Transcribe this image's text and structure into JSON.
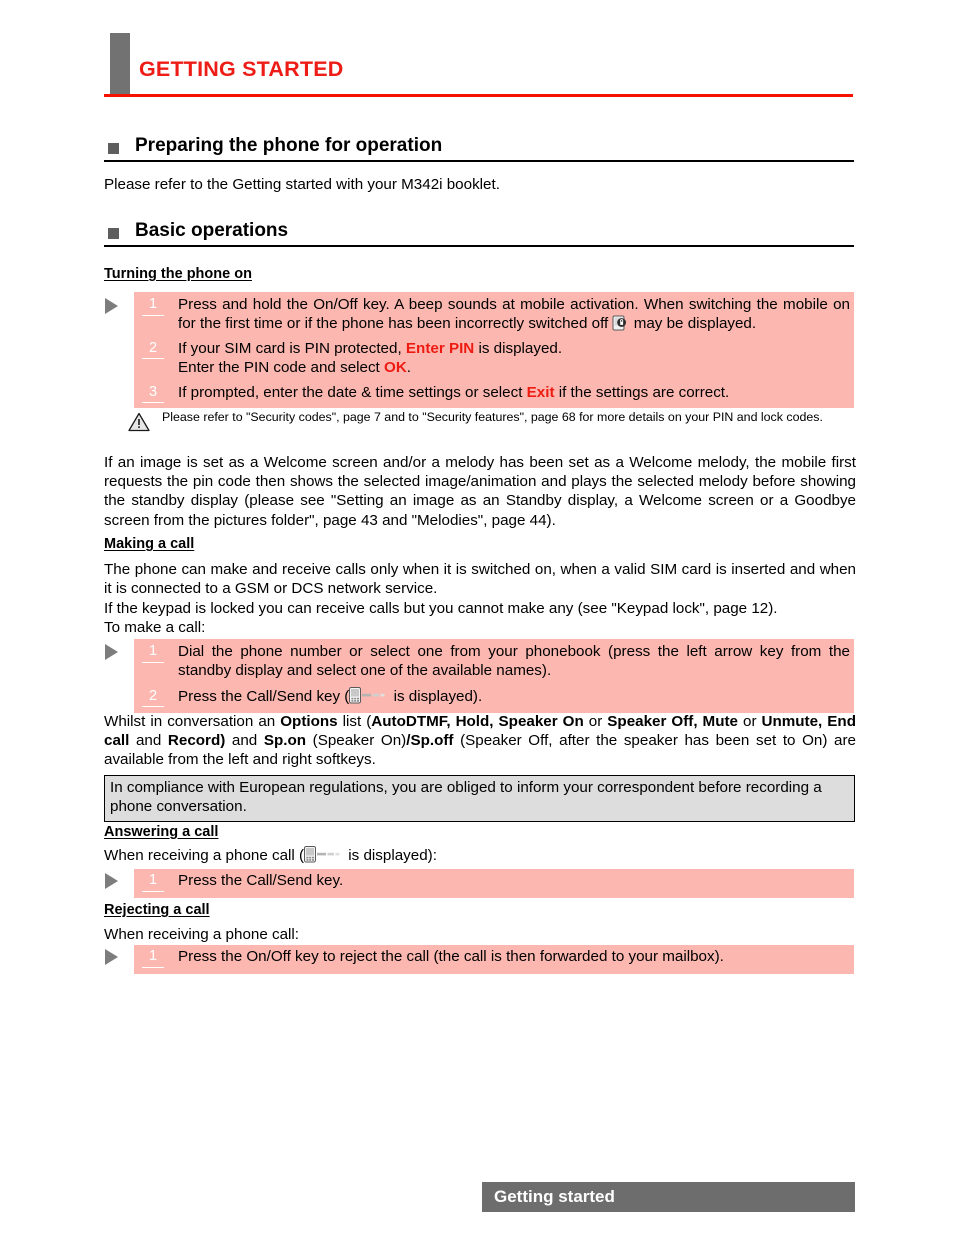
{
  "chapter": {
    "title": "GETTING STARTED",
    "accent_color": "#ed1c16",
    "tab_color": "#727272"
  },
  "sections": [
    {
      "id": "preparing",
      "title": "Preparing the phone for operation",
      "body": "Please refer to the Getting started with your M342i booklet."
    },
    {
      "id": "basic",
      "title": "Basic operations"
    }
  ],
  "turning_on": {
    "heading": "Turning the phone on",
    "steps": [
      {
        "num": "1",
        "text_a": "Press and hold the On/Off key. A beep sounds at mobile activation. When switching the mobile on for the first time or if the phone has been incorrectly switched off ",
        "icon": "lock-phone-icon",
        "text_b": " may be displayed."
      },
      {
        "num": "2",
        "text_a": "If your SIM card is PIN protected, ",
        "red_a": "Enter PIN",
        "text_b": " is displayed.",
        "text_c": "Enter the PIN code and select ",
        "red_b": "OK",
        "text_d": "."
      },
      {
        "num": "3",
        "text_a": "If prompted, enter the date & time settings or select ",
        "red_a": "Exit",
        "text_b": " if the settings are correct."
      }
    ],
    "warning": "Please refer to \"Security codes\", page 7 and to \"Security features\", page 68  for more details on your PIN and lock codes."
  },
  "welcome_paragraph": "If an image is set as a Welcome screen and/or a melody has been set as a Welcome melody, the mobile first requests the pin code then shows the selected image/animation and plays the selected melody before showing the standby display (please see \"Setting an image as an Standby display, a Welcome screen or a Goodbye screen from the pictures folder\", page 43 and \"Melodies\", page 44).",
  "making_a_call": {
    "heading": "Making a call",
    "paragraph_1": "The phone can make and receive calls only when it is switched on, when a valid SIM card is inserted and when it is connected to a GSM or DCS network service.",
    "paragraph_2": "If the keypad is locked you can receive calls but you cannot make any (see \"Keypad lock\", page 12).",
    "paragraph_3": "To make a call:",
    "steps": [
      {
        "num": "1",
        "text_a": "Dial the phone number or select one from your phonebook (press the left arrow key from the standby display and select one of the available names)."
      },
      {
        "num": "2",
        "text_a": "Press the Call/Send key (",
        "icon": "call-send-icon",
        "text_b": " is displayed)."
      }
    ]
  },
  "conversation_paragraph": {
    "p1": "Whilst in conversation an ",
    "b1": "Options",
    "p2": " list (",
    "b2": "AutoDTMF, Hold, Speaker On",
    "p3": " or ",
    "b3": "Speaker Off, Mute",
    "p4": " or ",
    "b4": "Unmute, End call",
    "p5": " and ",
    "b5": "Record)",
    "p6": " and ",
    "b6": "Sp.on",
    "p7": " (Speaker On)",
    "b7": "/Sp.off",
    "p8": " (Speaker Off, after the speaker has been set to On) are available from the left and right softkeys."
  },
  "compliance_note": "In compliance with European regulations, you are obliged to inform your correspondent before recording a phone conversation.",
  "answering_a_call": {
    "heading": "Answering a call",
    "lead_a": "When receiving a phone call (",
    "icon": "call-send-icon",
    "lead_b": " is displayed):",
    "steps": [
      {
        "num": "1",
        "text_a": "Press the Call/Send key."
      }
    ]
  },
  "rejecting_a_call": {
    "heading": "Rejecting a call",
    "lead": "When receiving a phone call:",
    "steps": [
      {
        "num": "1",
        "text_a": "Press the On/Off key to reject the call (the call is then forwarded to your mailbox)."
      }
    ]
  },
  "footer": {
    "label": "Getting started",
    "background": "#6d6d6d"
  },
  "colors": {
    "pink_box": "#fcb8b0",
    "gray_box": "#dddddd",
    "red_text": "#ee1b12",
    "heading_red": "#ed1c16"
  }
}
